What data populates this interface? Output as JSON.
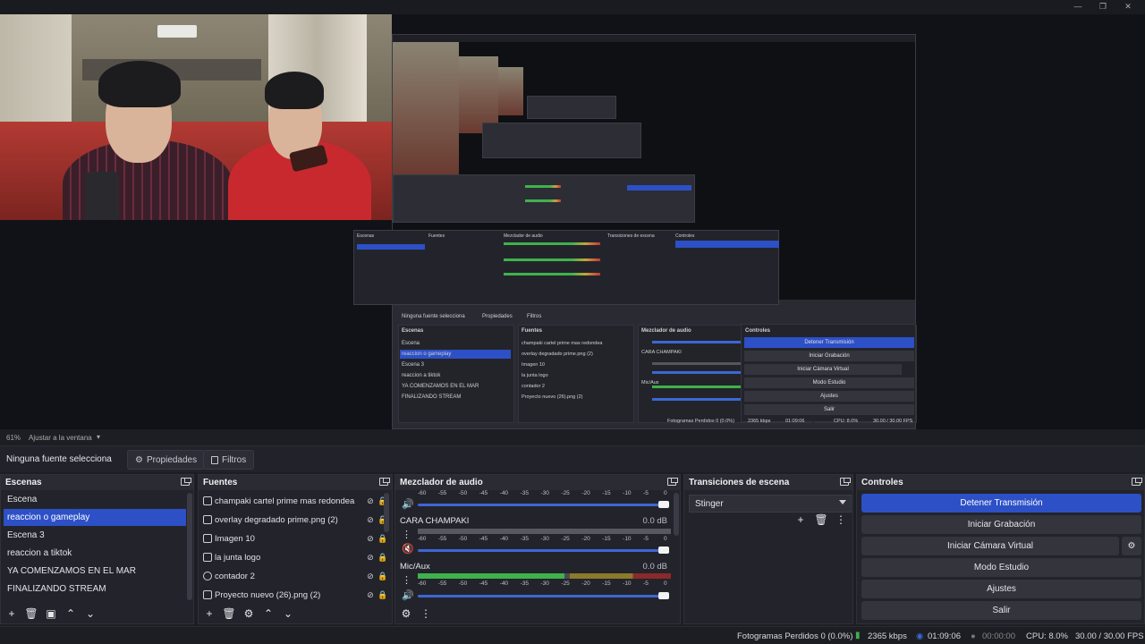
{
  "window": {
    "controls": [
      "minimize",
      "maximize",
      "close"
    ]
  },
  "preview": {
    "zoom": "61%",
    "zoom_mode": "Ajustar a la ventana"
  },
  "context": {
    "label": "Ninguna fuente selecciona",
    "properties": "Propiedades",
    "filters": "Filtros"
  },
  "scenes": {
    "title": "Escenas",
    "items": [
      "Escena",
      "reaccion o gameplay",
      "Escena 3",
      "reaccion a tiktok",
      "YA COMENZAMOS EN EL MAR",
      "FINALIZANDO STREAM"
    ],
    "selected_index": 1
  },
  "sources": {
    "title": "Fuentes",
    "items": [
      "champaki cartel prime mas redondea",
      "overlay degradado prime.png (2)",
      "Imagen 10",
      "la junta logo",
      "contador 2",
      "Proyecto nuevo (26).png (2)"
    ]
  },
  "mixer": {
    "title": "Mezclador de audio",
    "ticks": [
      "-60",
      "-55",
      "-50",
      "-45",
      "-40",
      "-35",
      "-30",
      "-25",
      "-20",
      "-15",
      "-10",
      "-5",
      "0"
    ],
    "channels": [
      {
        "name": "",
        "db": ""
      },
      {
        "name": "CARA CHAMPAKI",
        "db": "0.0 dB"
      },
      {
        "name": "Mic/Aux",
        "db": "0.0 dB"
      }
    ]
  },
  "transitions": {
    "title": "Transiciones de escena",
    "selected": "Stinger"
  },
  "controls": {
    "title": "Controles",
    "buttons": [
      "Detener Transmisión",
      "Iniciar Grabación",
      "Iniciar Cámara Virtual",
      "Modo Estudio",
      "Ajustes",
      "Salir"
    ]
  },
  "status": {
    "dropped": "Fotogramas Perdidos 0 (0.0%)",
    "bitrate": "2365 kbps",
    "stream_time": "01:09:06",
    "rec_time": "00:00:00",
    "cpu": "CPU: 8.0%",
    "fps": "30.00 / 30.00 FPS"
  },
  "colors": {
    "accent": "#2d50c7",
    "bg": "#1d1e23",
    "panel": "#23242b"
  }
}
